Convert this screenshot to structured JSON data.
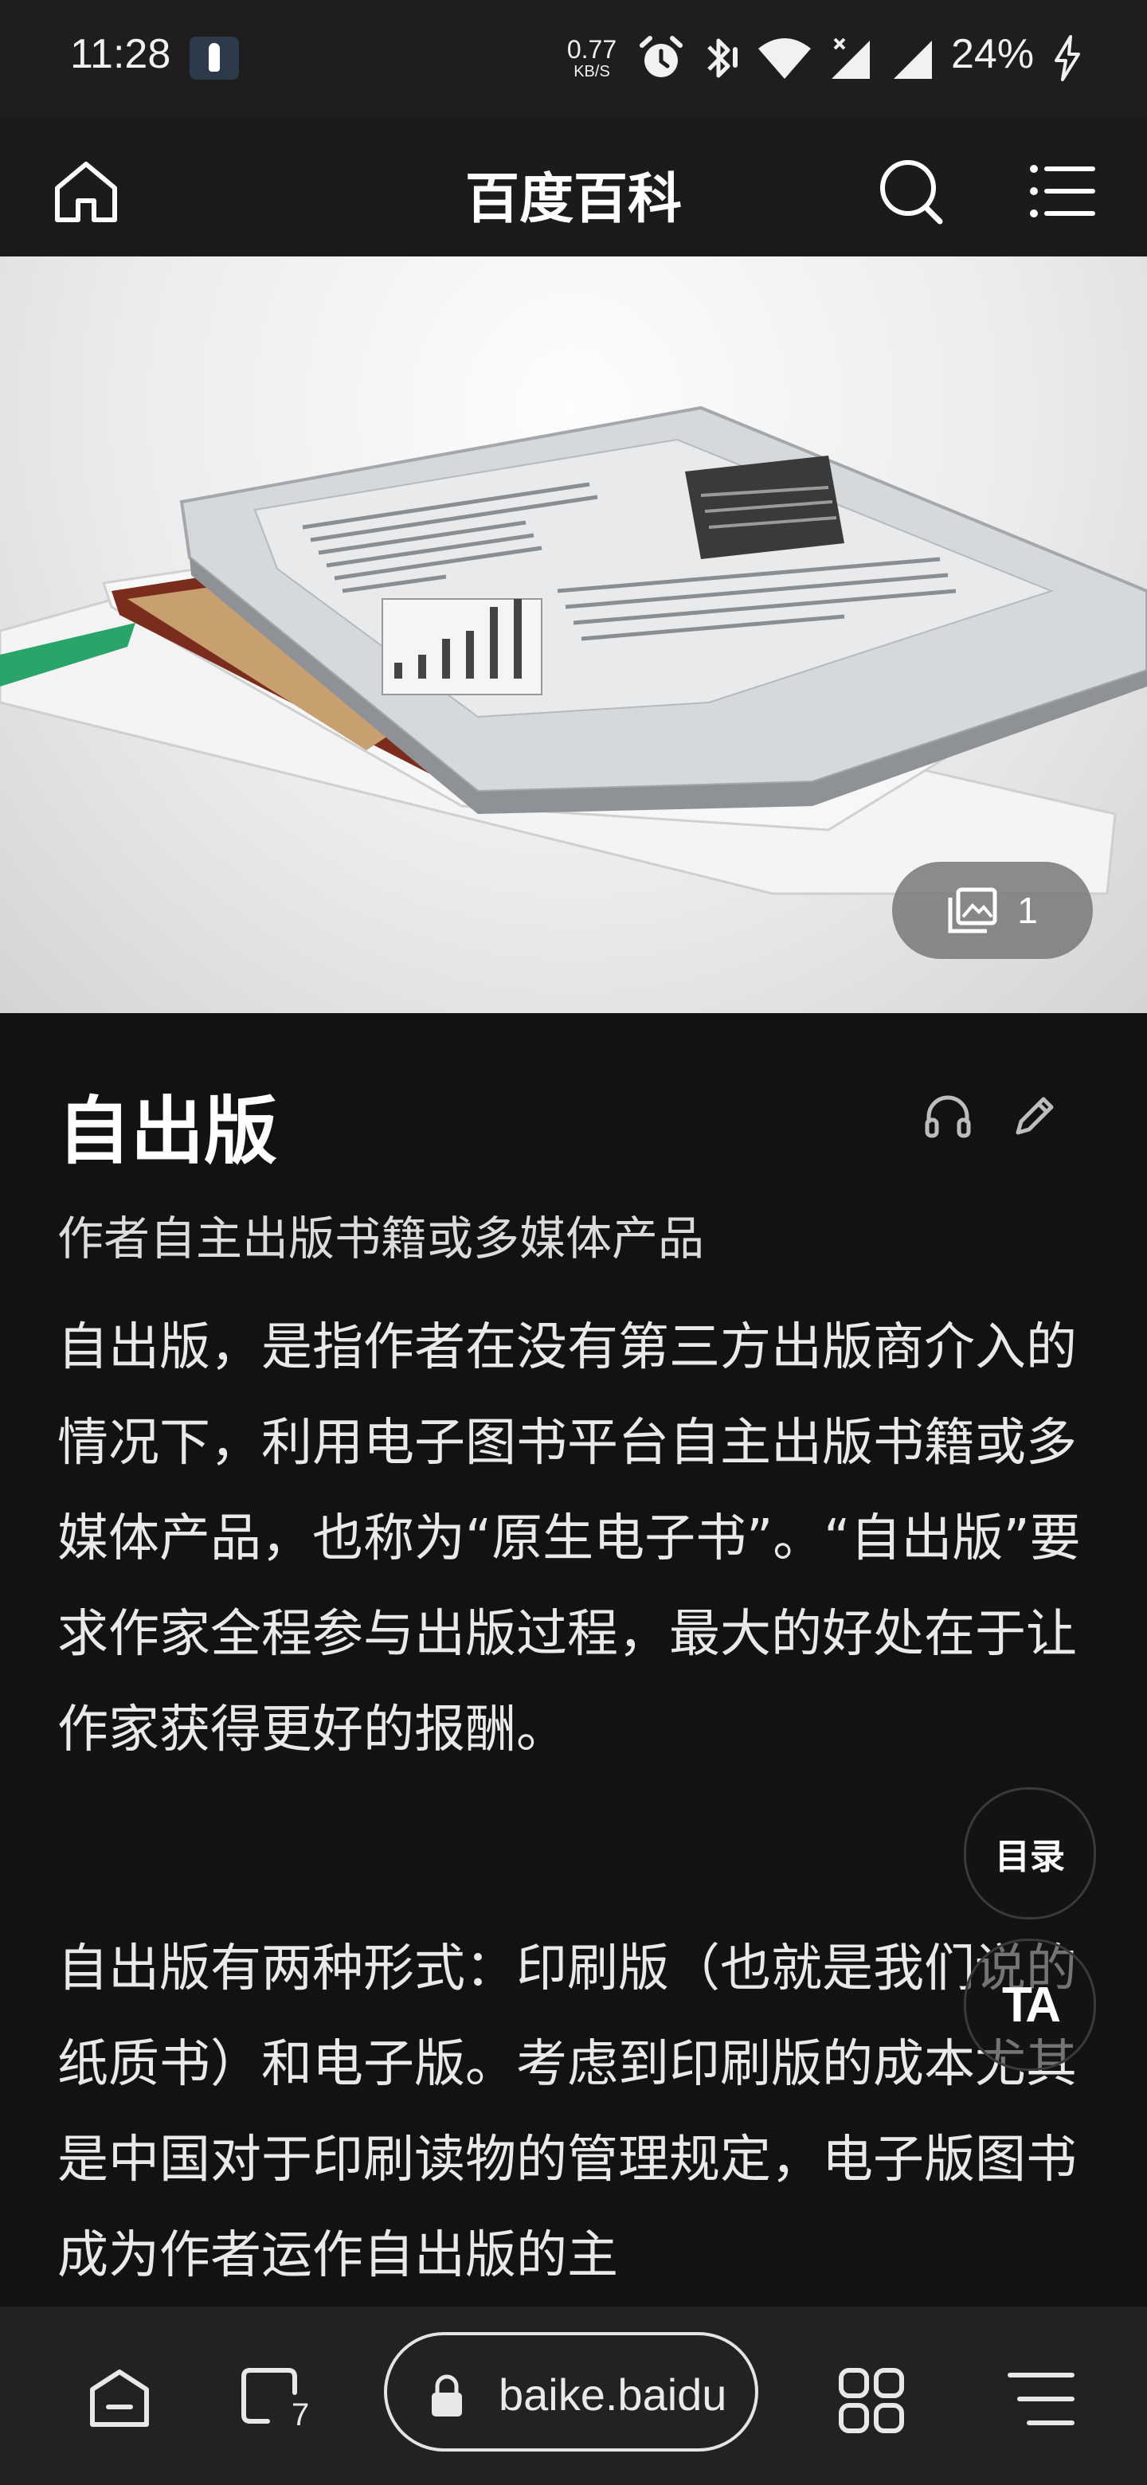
{
  "status_bar": {
    "time": "11:28",
    "net_speed_value": "0.77",
    "net_speed_unit": "KB/S",
    "battery": "24%",
    "icons": [
      "app-notification-icon",
      "alarm-icon",
      "bluetooth-icon",
      "wifi-icon",
      "signal-icon",
      "signal-icon",
      "charging-icon"
    ]
  },
  "top_nav": {
    "title": "百度百科",
    "icons": [
      "home-icon",
      "search-icon",
      "menu-icon"
    ]
  },
  "hero": {
    "gallery_count": "1",
    "icons": [
      "gallery-icon"
    ]
  },
  "article": {
    "title": "自出版",
    "subtitle": "作者自主出版书籍或多媒体产品",
    "paragraph1": "自出版，是指作者在没有第三方出版商介入的情况下，利用电子图书平台自主出版书籍或多媒体产品，也称为“原生电子书”。“自出版”要求作家全程参与出版过程，最大的好处在于让作家获得更好的报酬。",
    "paragraph2": "自出版有两种形式：印刷版（也就是我们说的纸质书）和电子版。考虑到印刷版的成本尤其是中国对于印刷读物的管理规定，电子版图书成为作者运作自出版的主",
    "icons": [
      "headphones-icon",
      "pencil-icon"
    ]
  },
  "floating": {
    "toc_label": "目录",
    "ta_label": "TA"
  },
  "bottom_bar": {
    "tab_count": "7",
    "url": "baike.baidu",
    "icons": [
      "home-icon",
      "tabs-icon",
      "lock-icon",
      "grid-icon",
      "menu-icon"
    ]
  }
}
